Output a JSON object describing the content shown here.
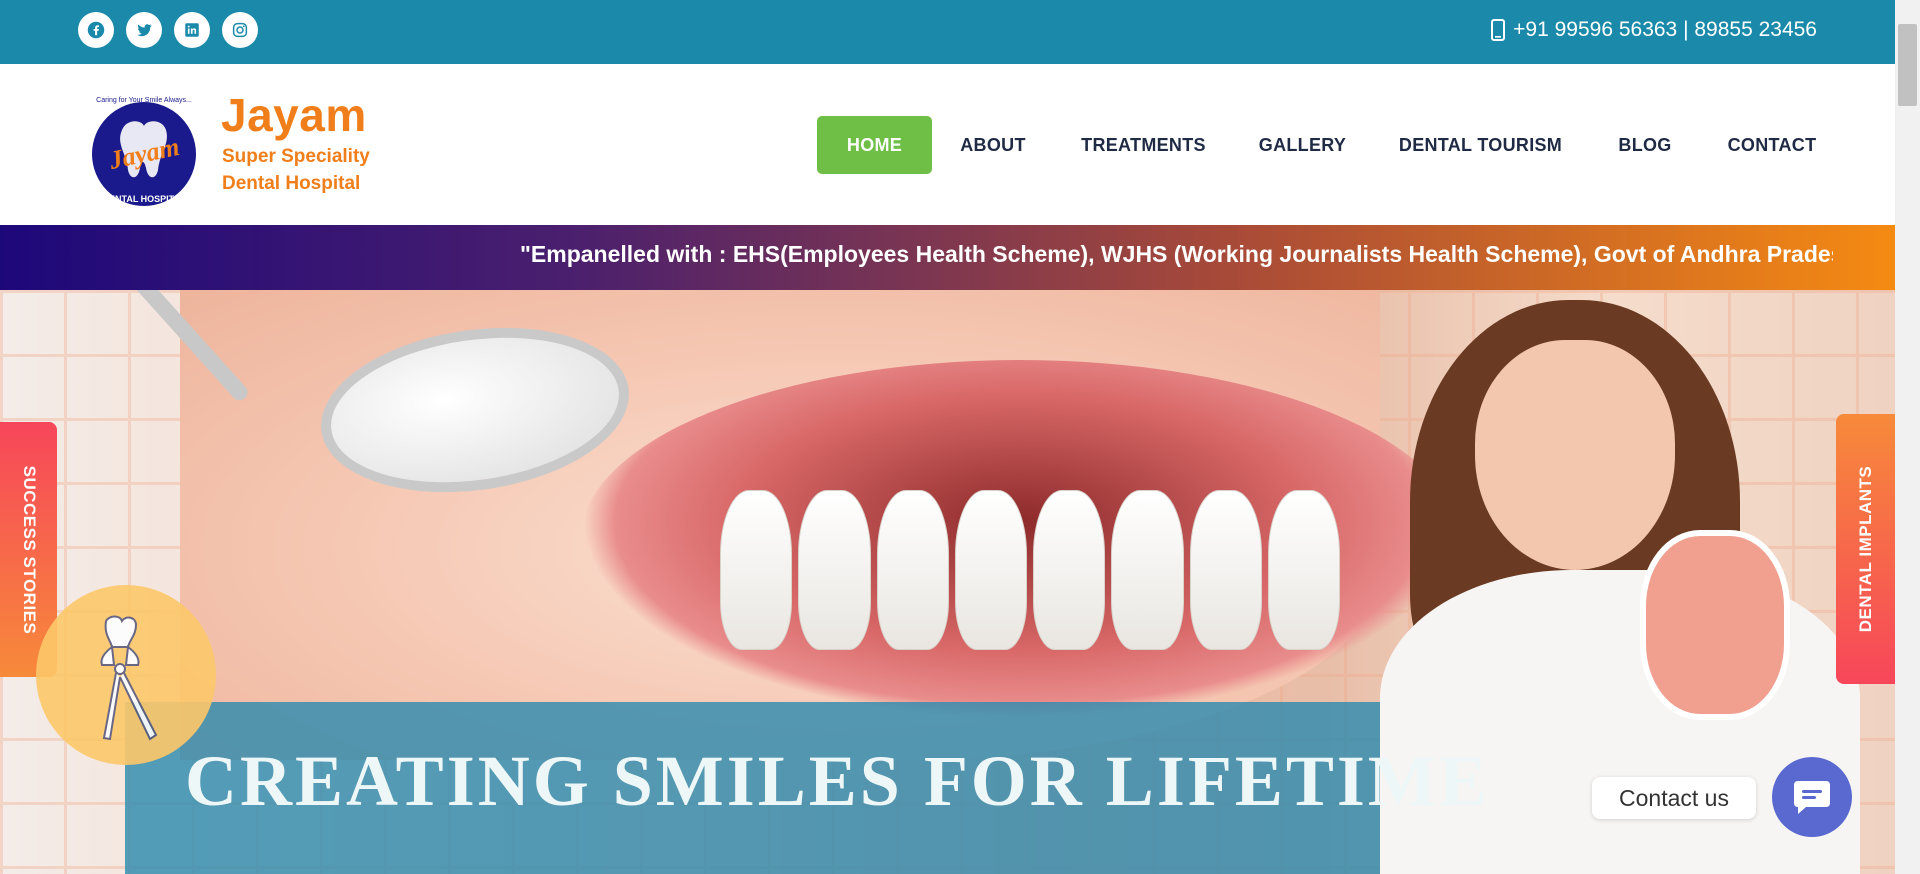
{
  "topbar": {
    "social": [
      "facebook-icon",
      "twitter-icon",
      "linkedin-icon",
      "instagram-icon"
    ],
    "phone": "+91 99596 56363 | 89855 23456",
    "bg_color": "#1b8aaa"
  },
  "logo": {
    "title": "Jayam",
    "subtitle_line1": "Super Speciality",
    "subtitle_line2": "Dental Hospital",
    "emblem_text": "Jayam",
    "emblem_tagline": "Caring for Your Smile Always...",
    "emblem_ring": "DENTAL HOSPITAL"
  },
  "nav": {
    "items": [
      "HOME",
      "ABOUT",
      "TREATMENTS",
      "GALLERY",
      "DENTAL TOURISM",
      "BLOG",
      "CONTACT"
    ],
    "active": "HOME",
    "active_color": "#6fbf46"
  },
  "banner": {
    "text": "\"Empanelled with : EHS(Employees Health Scheme), WJHS (Working Journalists Health Scheme), Govt of Andhra Pradesh\""
  },
  "hero": {
    "tagline": "CREATING SMILES FOR LIFETIME"
  },
  "side_tabs": {
    "left": "SUCCESS STORIES",
    "right": "DENTAL IMPLANTS"
  },
  "contact_widget": {
    "label": "Contact us",
    "icon": "chat-icon"
  }
}
